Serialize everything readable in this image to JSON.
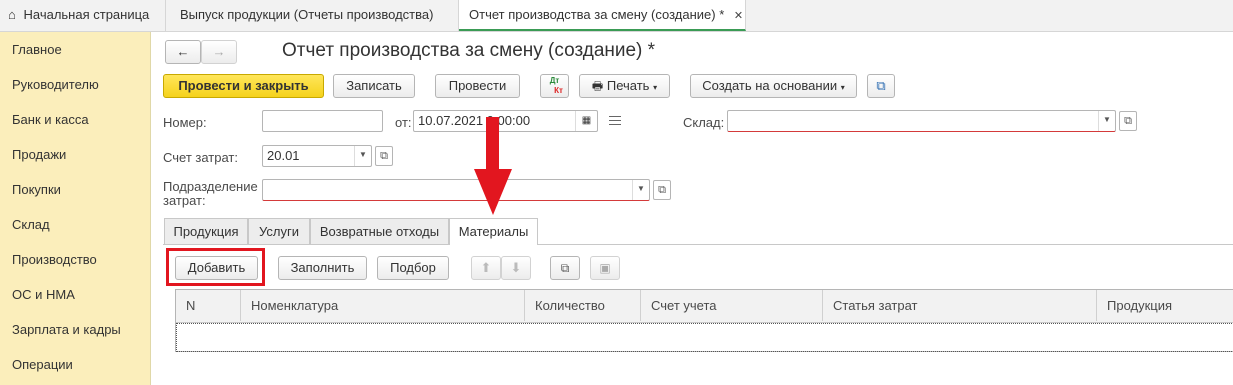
{
  "top_tabs": [
    {
      "label": "Начальная страница"
    },
    {
      "label": "Выпуск продукции (Отчеты производства)"
    },
    {
      "label": "Отчет производства за смену (создание) *",
      "close": "✕"
    }
  ],
  "sidebar": {
    "items": [
      "Главное",
      "Руководителю",
      "Банк и касса",
      "Продажи",
      "Покупки",
      "Склад",
      "Производство",
      "ОС и НМА",
      "Зарплата и кадры",
      "Операции"
    ]
  },
  "nav": {
    "back": "←",
    "forward": "→"
  },
  "form": {
    "title": "Отчет производства за смену (создание) *",
    "toolbar": {
      "post_close": "Провести и закрыть",
      "save": "Записать",
      "post": "Провести",
      "dtkt_top": "Дт",
      "dtkt_bottom": "Кт",
      "print": "Печать",
      "create_based": "Создать на основании"
    },
    "fields": {
      "number_label": "Номер:",
      "number_value": "",
      "date_label": "от:",
      "date_value": "10.07.2021 0:00:00",
      "warehouse_label": "Склад:",
      "warehouse_value": "",
      "cost_account_label": "Счет затрат:",
      "cost_account_value": "20.01",
      "division_label_1": "Подразделение",
      "division_label_2": "затрат:",
      "division_value": ""
    },
    "tabs": [
      "Продукция",
      "Услуги",
      "Возвратные отходы",
      "Материалы"
    ],
    "active_tab": "Материалы",
    "table_toolbar": {
      "add": "Добавить",
      "fill": "Заполнить",
      "select": "Подбор"
    },
    "table_columns": [
      "N",
      "Номенклатура",
      "Количество",
      "Счет учета",
      "Статья затрат",
      "Продукция"
    ]
  },
  "colors": {
    "accent": "#3a9b55",
    "primary_button": "#f5d21c",
    "sidebar": "#fbeebb",
    "highlight": "#e2161f"
  }
}
